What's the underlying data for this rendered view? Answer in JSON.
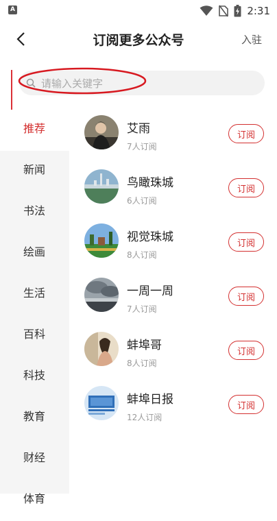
{
  "status_bar": {
    "left_badge": "A",
    "time": "2:31"
  },
  "header": {
    "title": "订阅更多公众号",
    "join_label": "入驻"
  },
  "search": {
    "placeholder": "请输入关键字"
  },
  "categories": [
    {
      "label": "推荐",
      "active": true
    },
    {
      "label": "新闻"
    },
    {
      "label": "书法"
    },
    {
      "label": "绘画"
    },
    {
      "label": "生活"
    },
    {
      "label": "百科"
    },
    {
      "label": "科技"
    },
    {
      "label": "教育"
    },
    {
      "label": "财经"
    },
    {
      "label": "体育"
    }
  ],
  "accounts": [
    {
      "name": "艾雨",
      "subscribers": "7人订阅",
      "button": "订阅"
    },
    {
      "name": "鸟瞰珠城",
      "subscribers": "6人订阅",
      "button": "订阅"
    },
    {
      "name": "视觉珠城",
      "subscribers": "8人订阅",
      "button": "订阅"
    },
    {
      "name": "一周一周",
      "subscribers": "7人订阅",
      "button": "订阅"
    },
    {
      "name": "蚌埠哥",
      "subscribers": "8人订阅",
      "button": "订阅"
    },
    {
      "name": "蚌埠日报",
      "subscribers": "12人订阅",
      "button": "订阅"
    }
  ],
  "colors": {
    "accent": "#d32f2f",
    "sidebar_bg": "#f5f5f5",
    "search_bg": "#f2f2f2"
  }
}
